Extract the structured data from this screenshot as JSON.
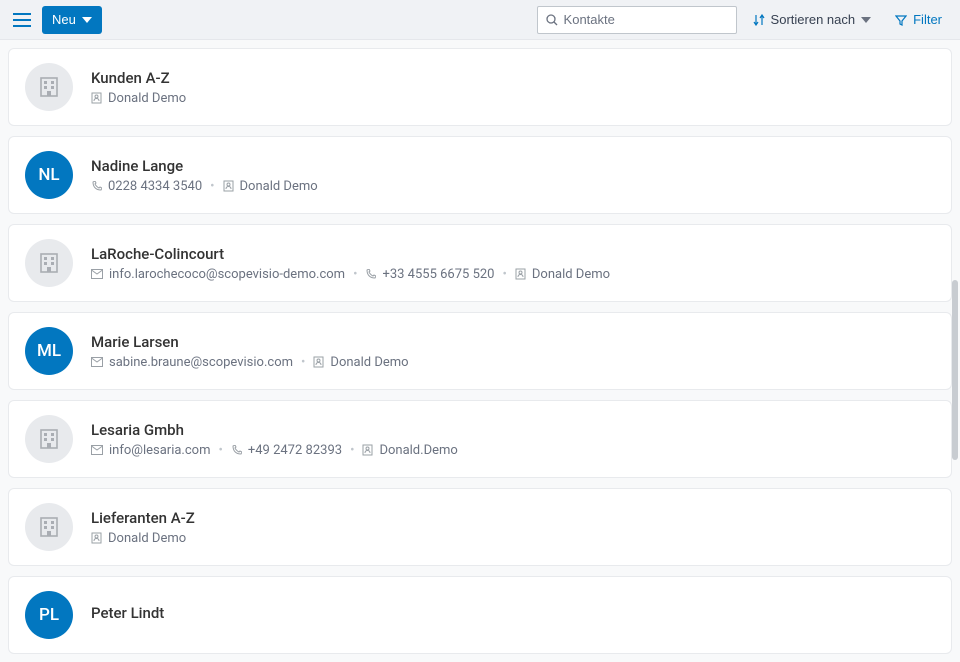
{
  "toolbar": {
    "new_label": "Neu",
    "search_placeholder": "Kontakte",
    "sort_label": "Sortieren nach",
    "filter_label": "Filter"
  },
  "contacts": [
    {
      "name": "Kunden A-Z",
      "avatar_type": "company",
      "initials": "",
      "email": "",
      "phone": "",
      "owner": "Donald Demo"
    },
    {
      "name": "Nadine Lange",
      "avatar_type": "person",
      "initials": "NL",
      "email": "",
      "phone": "0228 4334 3540",
      "owner": "Donald Demo"
    },
    {
      "name": "LaRoche-Colincourt",
      "avatar_type": "company",
      "initials": "",
      "email": "info.larochecoco@scopevisio-demo.com",
      "phone": "+33 4555 6675 520",
      "owner": "Donald Demo"
    },
    {
      "name": "Marie Larsen",
      "avatar_type": "person",
      "initials": "ML",
      "email": "sabine.braune@scopevisio.com",
      "phone": "",
      "owner": "Donald Demo"
    },
    {
      "name": "Lesaria Gmbh",
      "avatar_type": "company",
      "initials": "",
      "email": "info@lesaria.com",
      "phone": "+49 2472 82393",
      "owner": "Donald.Demo"
    },
    {
      "name": "Lieferanten A-Z",
      "avatar_type": "company",
      "initials": "",
      "email": "",
      "phone": "",
      "owner": "Donald Demo"
    },
    {
      "name": "Peter Lindt",
      "avatar_type": "person",
      "initials": "PL",
      "email": "",
      "phone": "",
      "owner": ""
    }
  ]
}
